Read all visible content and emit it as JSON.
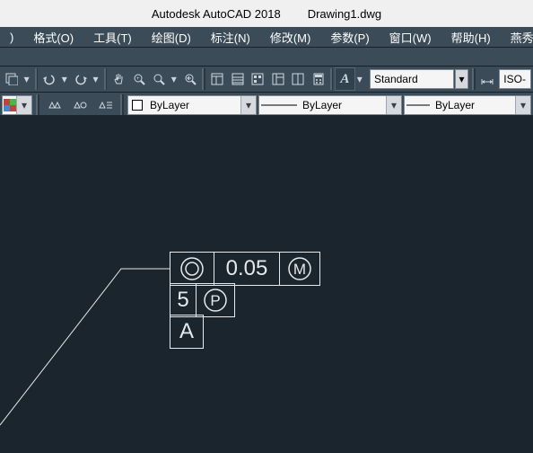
{
  "title": {
    "app": "Autodesk AutoCAD 2018",
    "file": "Drawing1.dwg"
  },
  "menu": {
    "format": "格式(O)",
    "tools": "工具(T)",
    "draw": "绘图(D)",
    "dim": "标注(N)",
    "modify": "修改(M)",
    "param": "参数(P)",
    "window": "窗口(W)",
    "help": "帮助(H)",
    "ext": "燕秀工具"
  },
  "toolbar1": {
    "textStyle": "Standard",
    "dimStyle": "ISO-"
  },
  "layerbar": {
    "colorCombo": "ByLayer",
    "ltypeCombo": "ByLayer",
    "lweightCombo": "ByLayer"
  },
  "gdt": {
    "row1": {
      "tol": "0.05",
      "mmc": "M"
    },
    "row2": {
      "val": "5",
      "proj": "P"
    },
    "row3": {
      "datum": "A"
    }
  }
}
